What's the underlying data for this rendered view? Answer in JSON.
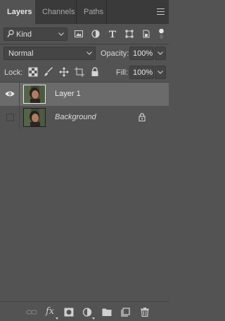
{
  "tabs": [
    {
      "label": "Layers",
      "active": true
    },
    {
      "label": "Channels",
      "active": false
    },
    {
      "label": "Paths",
      "active": false
    }
  ],
  "panel_menu_icon": "hamburger-menu-icon",
  "filter": {
    "kind_label": "Kind",
    "icons": [
      "pixel-layer-filter-icon",
      "adjustment-layer-filter-icon",
      "type-layer-filter-icon",
      "shape-layer-filter-icon",
      "smart-object-filter-icon"
    ]
  },
  "blend": {
    "mode": "Normal",
    "opacity_label": "Opacity:",
    "opacity_value": "100%"
  },
  "lock": {
    "label": "Lock:",
    "icons": [
      "lock-transparent-pixels-icon",
      "lock-image-pixels-icon",
      "lock-position-icon",
      "lock-artboard-icon",
      "lock-all-icon"
    ],
    "fill_label": "Fill:",
    "fill_value": "100%"
  },
  "layers": [
    {
      "name": "Layer 1",
      "visible": true,
      "selected": true,
      "locked": false
    },
    {
      "name": "Background",
      "visible": false,
      "selected": false,
      "locked": true
    }
  ],
  "bottom_icons": [
    "link-layers-icon",
    "fx-layer-style-icon",
    "add-mask-icon",
    "adjustment-layer-icon",
    "new-group-icon",
    "new-layer-icon",
    "delete-layer-icon"
  ],
  "bottom_fx_label": "fx",
  "colors": {
    "panel_bg": "#535353",
    "tab_bar_bg": "#3a3a3a",
    "selected_row": "#6b6b6b",
    "input_bg": "#454545"
  }
}
